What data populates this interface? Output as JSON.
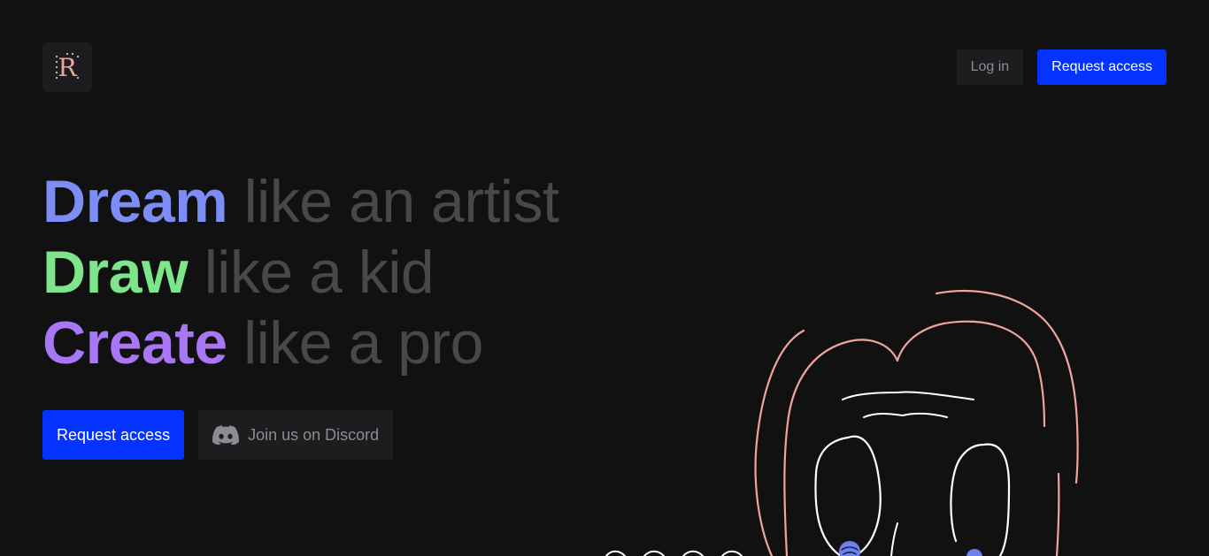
{
  "header": {
    "logo_letter": "R",
    "login_label": "Log in",
    "request_access_label": "Request access"
  },
  "hero": {
    "lines": [
      {
        "strong": "Dream",
        "rest": "like an artist"
      },
      {
        "strong": "Draw",
        "rest": "like a kid"
      },
      {
        "strong": "Create",
        "rest": "like a pro"
      }
    ],
    "cta_primary": "Request access",
    "cta_discord": "Join us on Discord"
  },
  "colors": {
    "background": "#111112",
    "accent_blue": "#0433ff",
    "dream": "#7c8ef6",
    "draw": "#7de58a",
    "create": "#a877f5",
    "muted_text": "#48484c",
    "sketch_pink": "#f0a4a0"
  },
  "icons": {
    "logo": "r-logo-icon",
    "discord": "discord-icon"
  }
}
